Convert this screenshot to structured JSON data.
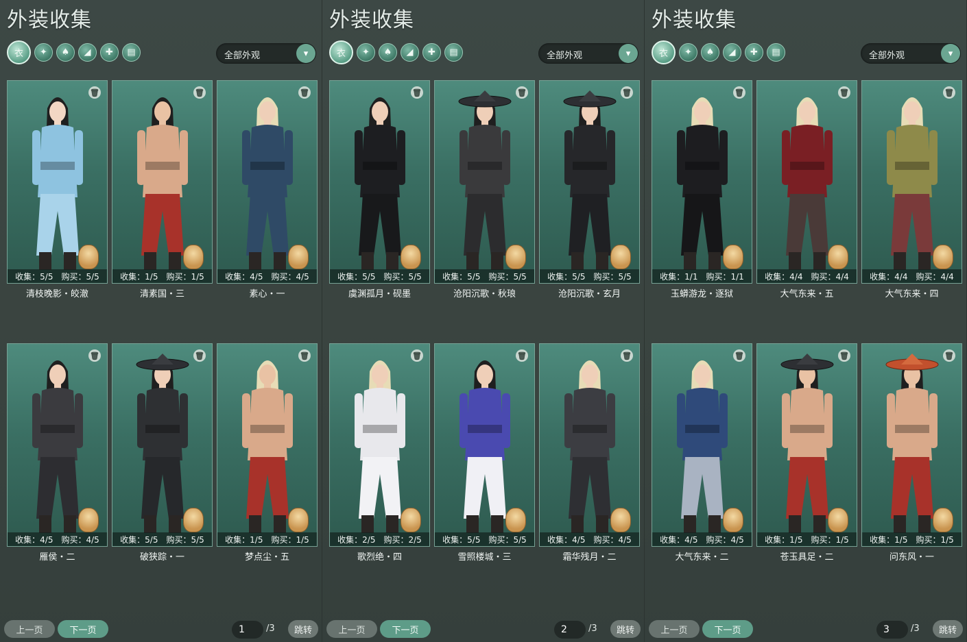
{
  "colors": {
    "panel_bg": "#3a4441",
    "card_bg": "#3a6f63",
    "accent": "#5e9c88"
  },
  "panels": [
    {
      "title": "外装收集",
      "filter": "全部外观",
      "page": "1",
      "total": "/3",
      "prev": "上一页",
      "next": "下一页",
      "jump": "跳转",
      "cards": [
        {
          "name": "清枝晚影・皎澈",
          "collect": "收集：5/5",
          "buy": "购买：5/5",
          "outfit": "#8ec3e0",
          "pants": "#a9d3ea",
          "skin": "#f2d7c4",
          "hair": "#1f1f1f",
          "hat": "none"
        },
        {
          "name": "清素国・三",
          "collect": "收集：1/5",
          "buy": "购买：1/5",
          "outfit": "#d9a98a",
          "pants": "#a8322a",
          "skin": "#e9c2a4",
          "hair": "#1f1f1f",
          "hat": "none"
        },
        {
          "name": "素心・一",
          "collect": "收集：4/5",
          "buy": "购买：4/5",
          "outfit": "#2f4a66",
          "pants": "#2f4a66",
          "skin": "#efcfb8",
          "hair": "#e7dcb6",
          "hat": "none"
        },
        {
          "name": "雁侯・二",
          "collect": "收集：4/5",
          "buy": "购买：4/5",
          "outfit": "#3b3b3f",
          "pants": "#2d2d31",
          "skin": "#efcfb8",
          "hair": "#1f1f1f",
          "hat": "none"
        },
        {
          "name": "破狭踪・一",
          "collect": "收集：5/5",
          "buy": "购买：5/5",
          "outfit": "#2e3033",
          "pants": "#26282b",
          "skin": "#efcfb8",
          "hair": "#1f1f1f",
          "hat": "dark"
        },
        {
          "name": "梦点尘・五",
          "collect": "收集：1/5",
          "buy": "购买：1/5",
          "outfit": "#d9a98a",
          "pants": "#a8322a",
          "skin": "#e9c2a4",
          "hair": "#e7dcb6",
          "hat": "none"
        }
      ]
    },
    {
      "title": "外装收集",
      "filter": "全部外观",
      "page": "2",
      "total": "/3",
      "prev": "上一页",
      "next": "下一页",
      "jump": "跳转",
      "cards": [
        {
          "name": "虞渊孤月・砚墨",
          "collect": "收集：5/5",
          "buy": "购买：5/5",
          "outfit": "#1d1e21",
          "pants": "#18191b",
          "skin": "#efcfb8",
          "hair": "#1f1f1f",
          "hat": "none"
        },
        {
          "name": "沧阳沉歌・秋琅",
          "collect": "收集：5/5",
          "buy": "购买：5/5",
          "outfit": "#3a3a3c",
          "pants": "#2c2c2e",
          "skin": "#efcfb8",
          "hair": "#1f1f1f",
          "hat": "dark"
        },
        {
          "name": "沧阳沉歌・玄月",
          "collect": "收集：5/5",
          "buy": "购买：5/5",
          "outfit": "#26272a",
          "pants": "#1f2023",
          "skin": "#efcfb8",
          "hair": "#1f1f1f",
          "hat": "dark"
        },
        {
          "name": "歌烈绝・四",
          "collect": "收集：2/5",
          "buy": "购买：2/5",
          "outfit": "#e8e8ec",
          "pants": "#f2f2f5",
          "skin": "#efcfb8",
          "hair": "#e7dcb6",
          "hat": "none"
        },
        {
          "name": "雪照楼城・三",
          "collect": "收集：5/5",
          "buy": "购买：5/5",
          "outfit": "#4a4ab0",
          "pants": "#f0f0f5",
          "skin": "#efcfb8",
          "hair": "#1f1f1f",
          "hat": "none"
        },
        {
          "name": "霜华残月・二",
          "collect": "收集：4/5",
          "buy": "购买：4/5",
          "outfit": "#3c3d42",
          "pants": "#2e2f33",
          "skin": "#efcfb8",
          "hair": "#e7dcb6",
          "hat": "none"
        }
      ]
    },
    {
      "title": "外装收集",
      "filter": "全部外观",
      "page": "3",
      "total": "/3",
      "prev": "上一页",
      "next": "下一页",
      "jump": "跳转",
      "cards": [
        {
          "name": "玉蟒游龙・逐狱",
          "collect": "收集：1/1",
          "buy": "购买：1/1",
          "outfit": "#1d1d20",
          "pants": "#161618",
          "skin": "#efcfb8",
          "hair": "#e7dcb6",
          "hat": "none"
        },
        {
          "name": "大气东来・五",
          "collect": "收集：4/4",
          "buy": "购买：4/4",
          "outfit": "#7a1f24",
          "pants": "#4a3a38",
          "skin": "#efcfb8",
          "hair": "#e7dcb6",
          "hat": "none"
        },
        {
          "name": "大气东来・四",
          "collect": "收集：4/4",
          "buy": "购买：4/4",
          "outfit": "#8e8a4a",
          "pants": "#7a3a3a",
          "skin": "#efcfb8",
          "hair": "#e7dcb6",
          "hat": "none"
        },
        {
          "name": "大气东来・二",
          "collect": "收集：4/5",
          "buy": "购买：4/5",
          "outfit": "#2f4a7a",
          "pants": "#a9b3c2",
          "skin": "#efcfb8",
          "hair": "#e7dcb6",
          "hat": "none"
        },
        {
          "name": "苍玉具足・二",
          "collect": "收集：1/5",
          "buy": "购买：1/5",
          "outfit": "#d9a98a",
          "pants": "#a8322a",
          "skin": "#e9c2a4",
          "hair": "#1f1f1f",
          "hat": "dark"
        },
        {
          "name": "问东风・一",
          "collect": "收集：1/5",
          "buy": "购买：1/5",
          "outfit": "#d9a98a",
          "pants": "#a8322a",
          "skin": "#e9c2a4",
          "hair": "#1f1f1f",
          "hat": "red"
        }
      ]
    }
  ],
  "category_icons": [
    "outfit-all-icon",
    "top-icon",
    "bottom-icon",
    "shoes-icon",
    "accessory-icon",
    "pants-icon"
  ],
  "category_glyphs": [
    "衣",
    "✦",
    "♠",
    "◢",
    "✚",
    "▤"
  ],
  "trash_glyph": "🗑",
  "dropdown_glyph": "▾"
}
